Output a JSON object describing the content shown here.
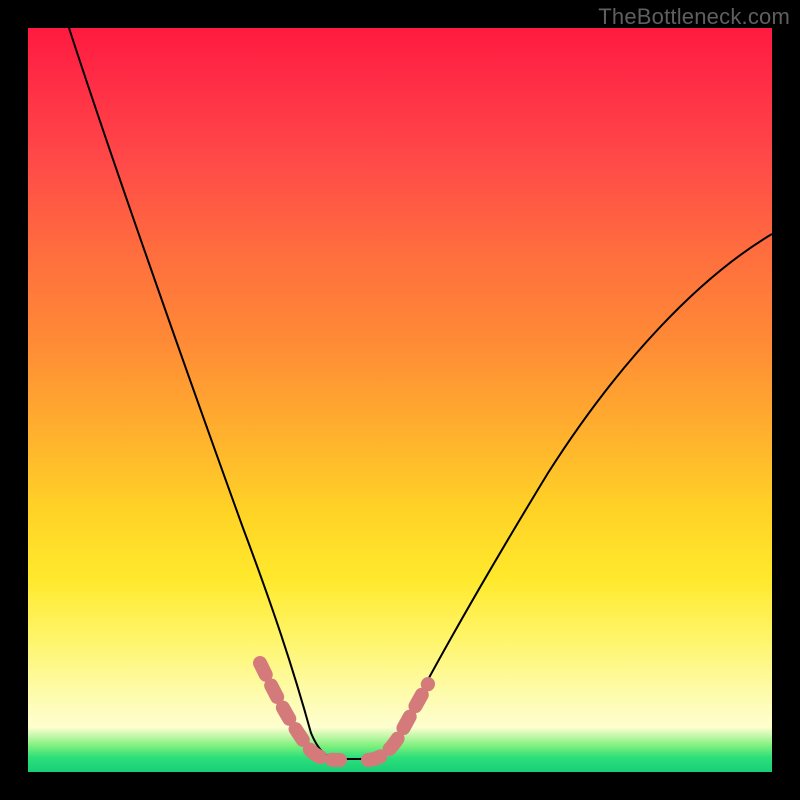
{
  "watermark": "TheBottleneck.com",
  "colors": {
    "frame": "#000000",
    "curve": "#000000",
    "markers": "#d47a7a",
    "gradient_stops": [
      "#ff1a3f",
      "#ff2a45",
      "#ff4a48",
      "#ff6d3e",
      "#ff8a36",
      "#ffb22d",
      "#ffd326",
      "#ffe92c",
      "#fff569",
      "#fdfcb0",
      "#fefed0",
      "#7df07d",
      "#2de07a",
      "#18cf77"
    ]
  },
  "chart_data": {
    "type": "line",
    "title": "",
    "xlabel": "",
    "ylabel": "",
    "xlim": [
      0,
      100
    ],
    "ylim": [
      0,
      100
    ],
    "note": "No axes or tick labels are rendered in the image. x/y values below are read off the plot area in percent of width/height (y measured from bottom=0, top=100). Curve traced from pixels; values approximate.",
    "series": [
      {
        "name": "left-branch",
        "x": [
          5.5,
          8,
          12,
          16,
          20,
          24,
          27,
          29.5,
          31.5,
          33.5,
          35,
          36.5,
          38
        ],
        "y": [
          100,
          88,
          71,
          57,
          44,
          33,
          24,
          17,
          12,
          7.5,
          4.5,
          2.5,
          2
        ]
      },
      {
        "name": "valley-floor",
        "x": [
          38,
          40,
          42,
          44,
          46
        ],
        "y": [
          2,
          1.5,
          1.5,
          1.5,
          2
        ]
      },
      {
        "name": "right-branch",
        "x": [
          46,
          48.5,
          51,
          55,
          60,
          66,
          73,
          82,
          92,
          100
        ],
        "y": [
          2,
          3.5,
          6,
          11,
          18,
          27,
          37,
          49,
          62,
          72
        ]
      }
    ],
    "markers": {
      "name": "highlighted-segments",
      "description": "Short dashed pink segments overlaying the curve near the valley bottom on both branches.",
      "left_segment_x_range": [
        31,
        38
      ],
      "right_segment_x_range": [
        46,
        52
      ],
      "color": "#d47a7a"
    }
  }
}
